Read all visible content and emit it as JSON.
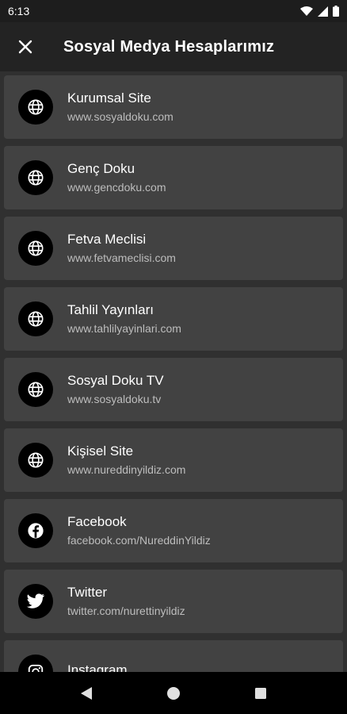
{
  "status_bar": {
    "time": "6:13"
  },
  "app_bar": {
    "title": "Sosyal Medya Hesaplarımız",
    "close_icon": "close-icon"
  },
  "accounts": [
    {
      "title": "Kurumsal Site",
      "url": "www.sosyaldoku.com",
      "icon": "globe-icon"
    },
    {
      "title": "Genç Doku",
      "url": "www.gencdoku.com",
      "icon": "globe-icon"
    },
    {
      "title": "Fetva Meclisi",
      "url": "www.fetvameclisi.com",
      "icon": "globe-icon"
    },
    {
      "title": "Tahlil Yayınları",
      "url": "www.tahlilyayinlari.com",
      "icon": "globe-icon"
    },
    {
      "title": "Sosyal Doku TV",
      "url": "www.sosyaldoku.tv",
      "icon": "globe-icon"
    },
    {
      "title": "Kişisel Site",
      "url": "www.nureddinyildiz.com",
      "icon": "globe-icon"
    },
    {
      "title": "Facebook",
      "url": "facebook.com/NureddinYildiz",
      "icon": "facebook-icon"
    },
    {
      "title": "Twitter",
      "url": "twitter.com/nurettinyildiz",
      "icon": "twitter-icon"
    },
    {
      "title": "Instagram",
      "url": "",
      "icon": "instagram-icon"
    }
  ],
  "nav_bar": {
    "back_icon": "back-icon",
    "home_icon": "home-icon",
    "recents_icon": "recents-icon"
  }
}
